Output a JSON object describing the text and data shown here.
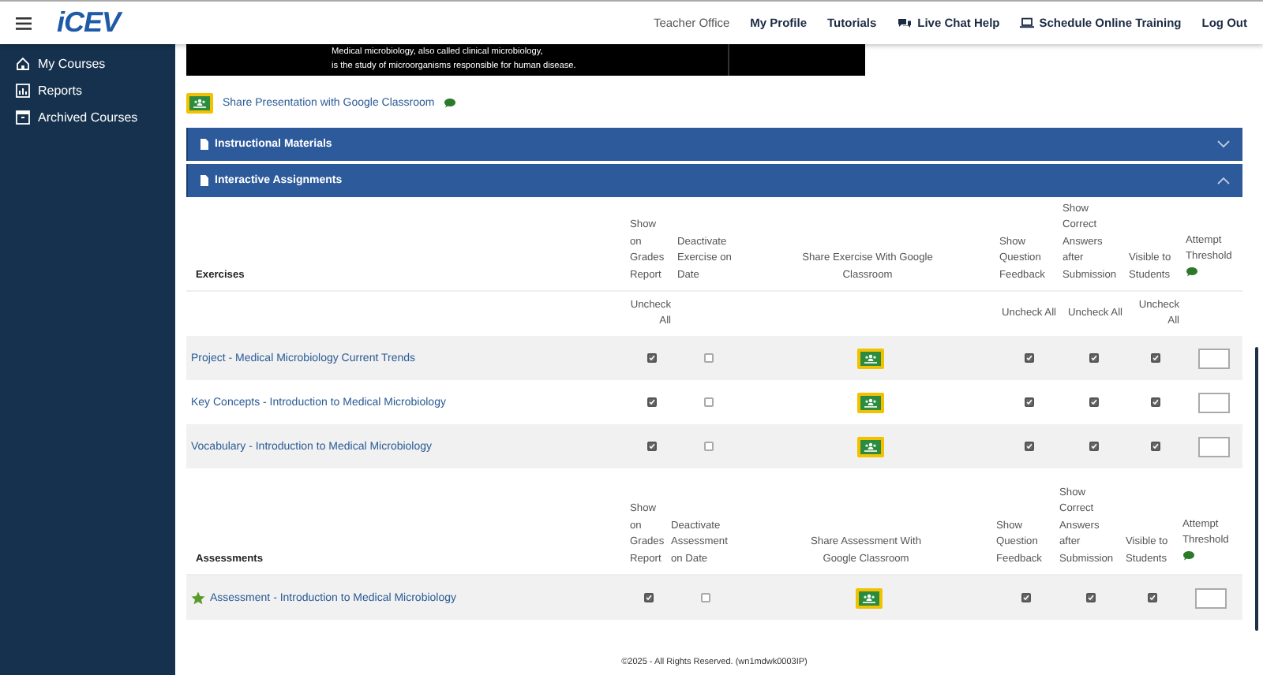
{
  "header": {
    "logo": "iCEV",
    "nav": [
      {
        "label": "Teacher Office",
        "kind": "muted"
      },
      {
        "label": "My Profile",
        "kind": "link"
      },
      {
        "label": "Tutorials",
        "kind": "link"
      },
      {
        "label": "Live Chat Help",
        "kind": "chat"
      },
      {
        "label": "Schedule Online Training",
        "kind": "laptop"
      },
      {
        "label": "Log Out",
        "kind": "link"
      }
    ]
  },
  "sidebar": {
    "items": [
      {
        "label": "My Courses",
        "kind": "home"
      },
      {
        "label": "Reports",
        "kind": "report"
      },
      {
        "label": "Archived Courses",
        "kind": "archive"
      }
    ]
  },
  "video": {
    "caption": [
      "Medical microbiology, also called clinical microbiology,",
      "is the study of microorganisms responsible for human disease."
    ]
  },
  "share_presentation": {
    "label": "Share Presentation with Google Classroom"
  },
  "sections": [
    {
      "title": "Instructional Materials",
      "expanded": false
    },
    {
      "title": "Interactive Assignments",
      "expanded": true
    }
  ],
  "tables": [
    {
      "kind": "exercises",
      "columns": [
        {
          "label": "Exercises"
        },
        {
          "label": "Show on Grades Report",
          "uncheck": "Uncheck All"
        },
        {
          "label": "Deactivate Exercise on Date"
        },
        {
          "label": "Share Exercise With Google Classroom"
        },
        {
          "label": "Show Question Feedback",
          "uncheck": "Uncheck All"
        },
        {
          "label": "Show Correct Answers after Submission",
          "uncheck": "Uncheck All"
        },
        {
          "label": "Visible to Students",
          "uncheck": "Uncheck All"
        },
        {
          "label": "Attempt Threshold"
        }
      ],
      "rows": [
        {
          "title": "Project - Medical Microbiology Current Trends",
          "starred": false,
          "grades_report": true,
          "deactivate": false,
          "feedback": true,
          "correct_answers": true,
          "visible": true
        },
        {
          "title": "Key Concepts - Introduction to Medical Microbiology",
          "starred": false,
          "grades_report": true,
          "deactivate": false,
          "feedback": true,
          "correct_answers": true,
          "visible": true
        },
        {
          "title": "Vocabulary - Introduction to Medical Microbiology",
          "starred": false,
          "grades_report": true,
          "deactivate": false,
          "feedback": true,
          "correct_answers": true,
          "visible": true
        }
      ]
    },
    {
      "kind": "assessments",
      "columns": [
        {
          "label": "Assessments"
        },
        {
          "label": "Show on Grades Report"
        },
        {
          "label": "Deactivate Assessment on Date"
        },
        {
          "label": "Share Assessment With Google Classroom"
        },
        {
          "label": "Show Question Feedback"
        },
        {
          "label": "Show Correct Answers after Submission"
        },
        {
          "label": "Visible to Students"
        },
        {
          "label": "Attempt Threshold"
        }
      ],
      "rows": [
        {
          "title": "Assessment - Introduction to Medical Microbiology",
          "starred": true,
          "grades_report": true,
          "deactivate": false,
          "feedback": true,
          "correct_answers": true,
          "visible": true
        }
      ]
    }
  ],
  "footer": "©2025 - All Rights Reserved. (wn1mdwk0003IP)"
}
